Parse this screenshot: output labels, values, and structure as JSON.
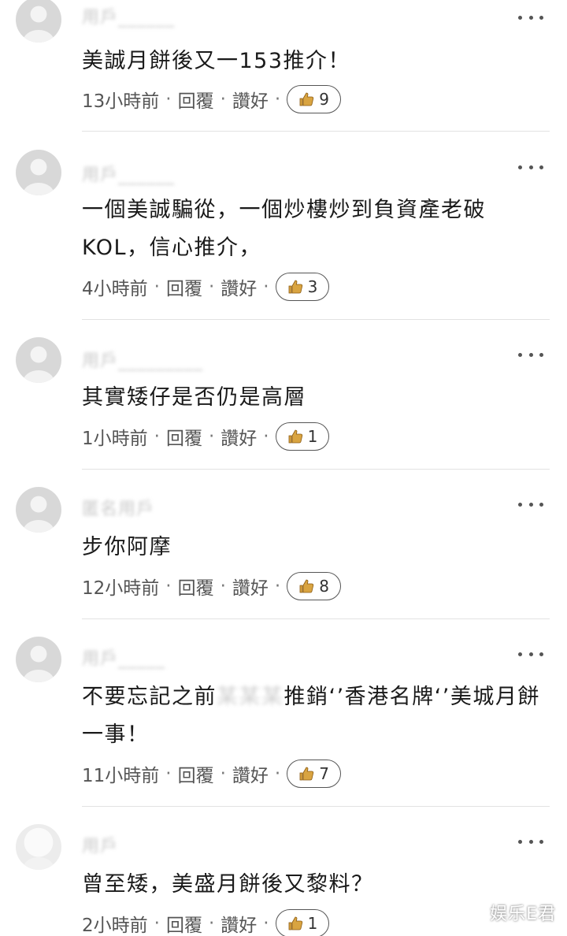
{
  "colors": {
    "text": "#1a1a1a",
    "meta": "#555555",
    "divider": "#e2e2e2",
    "thumb": "#d9a441"
  },
  "icons": {
    "like": "thumbs-up-icon",
    "more": "more-dots-icon"
  },
  "comments": [
    {
      "text": "美誠月餅後又一153推介！",
      "time": "13小時前",
      "reply": "回覆",
      "like": "讚好",
      "likes": "9"
    },
    {
      "text": "一個美誠騙從，一個炒樓炒到負資產老破KOL，信心推介，",
      "time": "4小時前",
      "reply": "回覆",
      "like": "讚好",
      "likes": "3"
    },
    {
      "text": "其實矮仔是否仍是高層",
      "time": "1小時前",
      "reply": "回覆",
      "like": "讚好",
      "likes": "1"
    },
    {
      "text": "步你阿摩",
      "time": "12小時前",
      "reply": "回覆",
      "like": "讚好",
      "likes": "8"
    },
    {
      "text_a": "不要忘記之前",
      "text_b": "推銷‘’香港名牌‘’美城月餅一事！",
      "time": "11小時前",
      "reply": "回覆",
      "like": "讚好",
      "likes": "7"
    },
    {
      "text": "曾至矮，美盛月餅後又黎料？",
      "time": "2小時前",
      "reply": "回覆",
      "like": "讚好",
      "likes": "1"
    }
  ],
  "watermark": "娱乐E君"
}
